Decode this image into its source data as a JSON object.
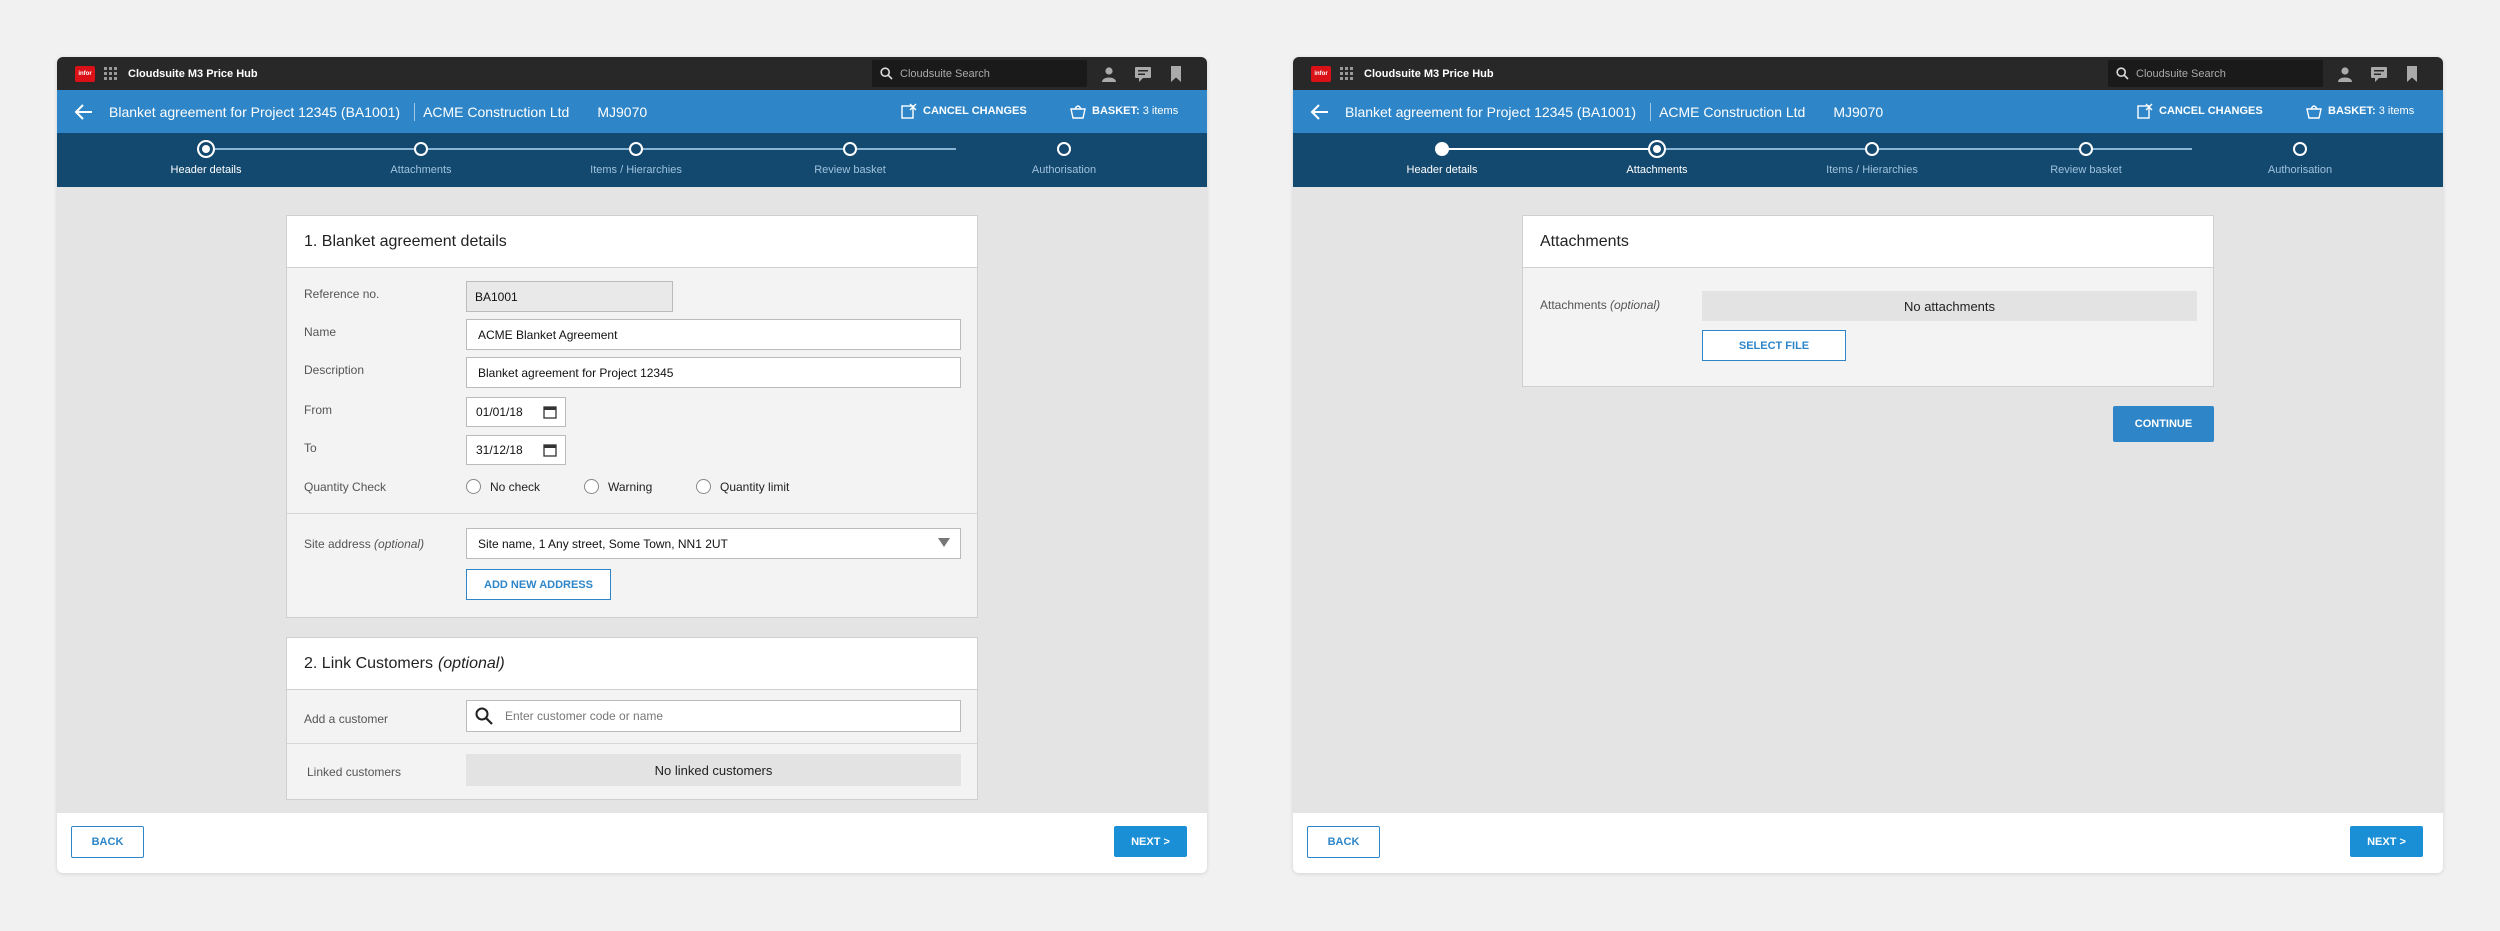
{
  "app": {
    "logo_text": "infor",
    "title": "Cloudsuite M3 Price Hub",
    "search_placeholder": "Cloudsuite Search"
  },
  "header": {
    "title": "Blanket agreement for Project 12345 (BA1001)",
    "company": "ACME Construction Ltd",
    "code": "MJ9070",
    "cancel_label": "CANCEL CHANGES",
    "basket_label": "BASKET:",
    "basket_count": "3 items"
  },
  "steps": [
    {
      "label": "Header details"
    },
    {
      "label": "Attachments"
    },
    {
      "label": "Items / Hierarchies"
    },
    {
      "label": "Review basket"
    },
    {
      "label": "Authorisation"
    }
  ],
  "left": {
    "current_step": 0,
    "section1": {
      "title": "1. Blanket agreement details",
      "reference_label": "Reference no.",
      "reference_value": "BA1001",
      "name_label": "Name",
      "name_value": "ACME Blanket Agreement",
      "description_label": "Description",
      "description_value": "Blanket agreement for Project 12345",
      "from_label": "From",
      "from_value": "01/01/18",
      "to_label": "To",
      "to_value": "31/12/18",
      "quantity_label": "Quantity Check",
      "quantity_options": [
        "No check",
        "Warning",
        "Quantity limit"
      ],
      "site_label": "Site address",
      "site_optional": "(optional)",
      "site_value": "Site name, 1 Any street, Some Town, NN1 2UT",
      "add_address_label": "ADD NEW ADDRESS"
    },
    "section2": {
      "title": "2. Link Customers",
      "title_optional": "(optional)",
      "add_customer_label": "Add a customer",
      "customer_placeholder": "Enter customer code or name",
      "linked_label": "Linked customers",
      "linked_empty": "No linked customers"
    }
  },
  "right": {
    "current_step": 1,
    "attachments": {
      "title": "Attachments",
      "label": "Attachments",
      "label_optional": "(optional)",
      "empty_text": "No attachments",
      "select_file_label": "SELECT FILE",
      "continue_label": "CONTINUE"
    }
  },
  "footer": {
    "back_label": "BACK",
    "next_label": "NEXT >"
  }
}
